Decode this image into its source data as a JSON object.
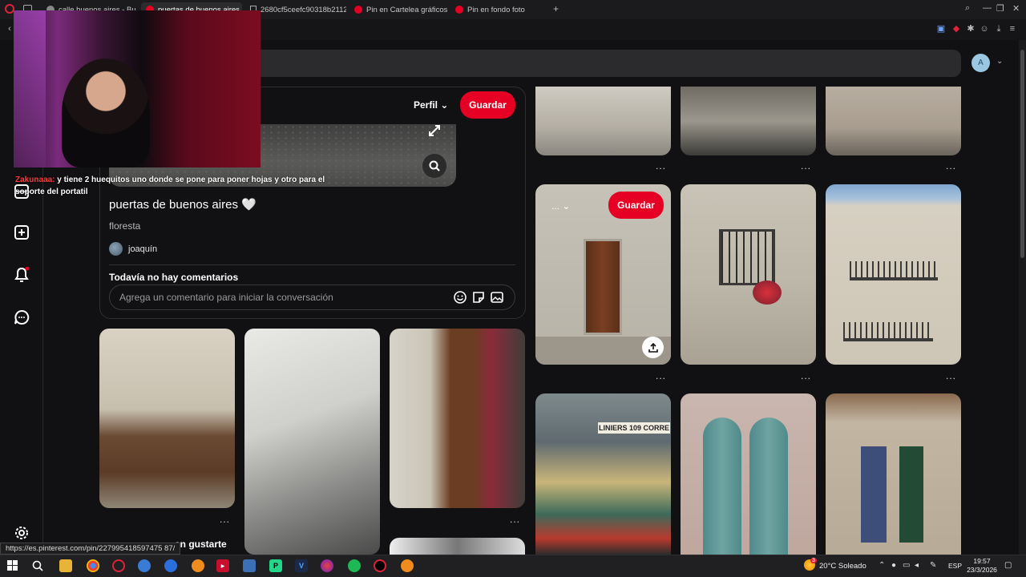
{
  "browser": {
    "tabs": [
      {
        "label": "calle buenos aires - Busc",
        "icon": "google-icon"
      },
      {
        "label": "puertas de buenos aires 🤍",
        "icon": "pinterest-icon",
        "active": true
      },
      {
        "label": "2680cf5ceefc90318b2112",
        "icon": "document-icon"
      },
      {
        "label": "Pin en Cartelea gráficos",
        "icon": "pinterest-icon"
      },
      {
        "label": "Pin en fondo foto",
        "icon": "pinterest-icon"
      }
    ],
    "new_tab": "+"
  },
  "header": {
    "avatar_letter": "A"
  },
  "pin": {
    "profile_label": "Perfil",
    "save_label": "Guardar",
    "title": "puertas de buenos aires 🤍",
    "subtitle": "floresta",
    "user_name": "joaquín",
    "no_comments": "Todavía no hay comentarios",
    "comment_placeholder": "Agrega un comentario para iniciar la conversación"
  },
  "grid": {
    "save_label": "Guardar",
    "more_dots": "...",
    "bus_sign": "LINIERS 109 CORRE"
  },
  "stream_chat": {
    "user": "Zakunaaa:",
    "message": "y tiene 2 huequitos uno donde se pone para poner hojas y otro para el soporte del portatil"
  },
  "status_url": "https://es.pinterest.com/pin/227995418597475 87/",
  "more_heading": "an gustarte",
  "taskbar": {
    "weather": "20°C  Soleado",
    "language": "ESP",
    "time": "19:57",
    "date": "23/3/2026",
    "notif_count": "3"
  },
  "colors": {
    "brand_red": "#e60023",
    "page_bg": "#111113"
  }
}
